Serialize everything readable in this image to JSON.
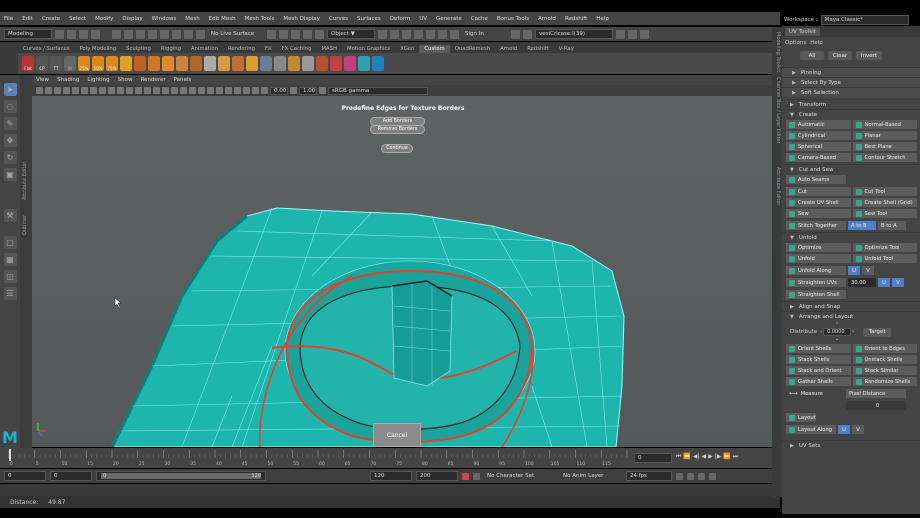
{
  "menubar": [
    "File",
    "Edit",
    "Create",
    "Select",
    "Modify",
    "Display",
    "Windows",
    "Mesh",
    "Edit Mesh",
    "Mesh Tools",
    "Mesh Display",
    "Curves",
    "Surfaces",
    "Deform",
    "UV",
    "Generate",
    "Cache",
    "Bonus Tools",
    "Arnold",
    "Redshift",
    "Help"
  ],
  "workspace": {
    "label": "Workspace :",
    "value": "Maya Classic*"
  },
  "status": {
    "mode": "Modeling",
    "live_surface": "No Live Surface",
    "object_field": "Object ▼",
    "signin": "Sign In",
    "input_field": "vesiCrlcase:l(39)"
  },
  "shelf_tabs": [
    "Curves / Surfaces",
    "Poly Modeling",
    "Sculpting",
    "Rigging",
    "Animation",
    "Rendering",
    "FX",
    "FX Caching",
    "MASH",
    "Motion Graphics",
    "XGen",
    "Custom",
    "QuadRemesh",
    "Arnold",
    "Redshift",
    "V-Ray"
  ],
  "shelf_active": "Custom",
  "shelf_badges": [
    "Flat",
    "CP",
    "TT",
    "25%",
    "50%",
    "75%"
  ],
  "panel_menu": [
    "View",
    "Shading",
    "Lighting",
    "Show",
    "Renderer",
    "Panels"
  ],
  "panel_fields": {
    "field1": "0.00",
    "field2": "1.00",
    "colorspace": "sRGB gamma"
  },
  "viewport_dialog": {
    "title": "Predefine Edges for Texture Borders",
    "add": "Add Borders",
    "remove": "Remove Borders",
    "continue": "Continue",
    "cancel": "Cancel"
  },
  "left_strips": [
    "Attribute Editor",
    "Outliner"
  ],
  "right_strips": [
    "Modeling Toolkit",
    "Channel Box / Layer Editor",
    "Attribute Editor"
  ],
  "timeline": {
    "ticks": [
      "0",
      "5",
      "10",
      "15",
      "20",
      "25",
      "30",
      "35",
      "40",
      "45",
      "50",
      "55",
      "60",
      "65",
      "70",
      "75",
      "80",
      "85",
      "90",
      "95",
      "100",
      "105",
      "110",
      "115",
      "120"
    ],
    "current": "0"
  },
  "range": {
    "start": "0",
    "start2": "0",
    "slider_start": "0",
    "slider_end": "120",
    "end": "120",
    "end2": "200",
    "char_set": "No Character Set",
    "anim_layer": "No Anim Layer",
    "fps": "24 fps"
  },
  "helpline": {
    "label": "Distance:",
    "value": "49.87"
  },
  "uv_toolkit": {
    "title": "UV Toolkit",
    "menu": [
      "Options",
      "Help"
    ],
    "top_buttons": [
      "All",
      "Clear",
      "Invert"
    ],
    "pinning": "Pinning",
    "select_by_type": "Select By Type",
    "soft_selection": "Soft Selection",
    "transform": "Transform",
    "create": {
      "label": "Create",
      "buttons": [
        "Automatic",
        "Normal-Based",
        "Cylindrical",
        "Planar",
        "Spherical",
        "Best Plane",
        "Camera-Based",
        "Contour Stretch"
      ]
    },
    "cut_sew": {
      "label": "Cut and Sew",
      "auto_seams": "Auto Seams",
      "buttons": [
        "Cut",
        "Cut Tool",
        "Create UV Shell",
        "Create Shell (Grid)",
        "Sew",
        "Sew Tool"
      ],
      "stitch": "Stitch Together",
      "stitch_a": "A to B",
      "stitch_b": "B to A"
    },
    "unfold": {
      "label": "Unfold",
      "buttons": [
        "Optimize",
        "Optimize Tool",
        "Unfold",
        "Unfold Tool"
      ],
      "unfold_along": "Unfold Along",
      "u": "U",
      "v": "V",
      "straighten_uvs": "Straighten UVs",
      "straighten_value": "30.00",
      "straighten_shell": "Straighten Shell"
    },
    "align_snap": "Align and Snap",
    "arrange": {
      "label": "Arrange and Layout",
      "distribute": "Distribute",
      "distribute_value": "0.0000",
      "target": "Target",
      "buttons": [
        "Orient Shells",
        "Orient to Edges",
        "Stack Shells",
        "Unstack Shells",
        "Stack and Orient",
        "Stack Similar",
        "Gather Shells",
        "Randomize Shells"
      ],
      "measure": "Measure",
      "measure_value": "Pixel Distance",
      "measure_num": "0",
      "layout": "Layout",
      "layout_along": "Layout Along",
      "u": "U",
      "v": "V"
    },
    "uv_sets": "UV Sets"
  }
}
